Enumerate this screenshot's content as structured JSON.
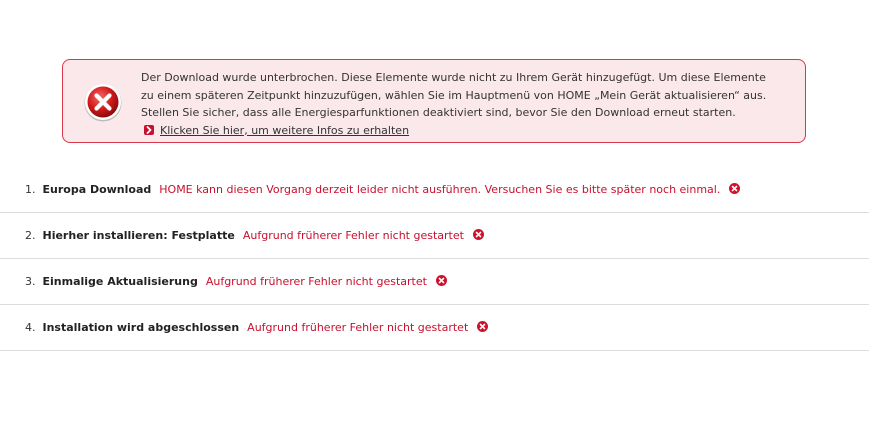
{
  "alert": {
    "icon": "error-x-icon",
    "message": "Der Download wurde unterbrochen. Diese Elemente wurde nicht zu Ihrem Gerät hinzugefügt. Um diese Elemente zu einem späteren Zeitpunkt hinzuzufügen, wählen Sie im Hauptmenü von HOME „Mein Gerät aktualisieren“ aus. Stellen Sie sicher, dass alle Energiesparfunktionen deaktiviert sind, bevor Sie den Download erneut starten.",
    "link_label": "Klicken Sie hier, um weitere Infos zu erhalten",
    "colors": {
      "border": "#d8384a",
      "background": "#fbe8ea",
      "accent": "#c8102e"
    }
  },
  "steps": [
    {
      "number": "1.",
      "title": "Europa Download",
      "status": "HOME kann diesen Vorgang derzeit leider nicht ausführen. Versuchen Sie es bitte später noch einmal.",
      "icon": "error-icon"
    },
    {
      "number": "2.",
      "title": "Hierher installieren: Festplatte",
      "status": "Aufgrund früherer Fehler nicht gestartet",
      "icon": "error-icon"
    },
    {
      "number": "3.",
      "title": "Einmalige Aktualisierung",
      "status": "Aufgrund früherer Fehler nicht gestartet",
      "icon": "error-icon"
    },
    {
      "number": "4.",
      "title": "Installation wird abgeschlossen",
      "status": "Aufgrund früherer Fehler nicht gestartet",
      "icon": "error-icon"
    }
  ]
}
